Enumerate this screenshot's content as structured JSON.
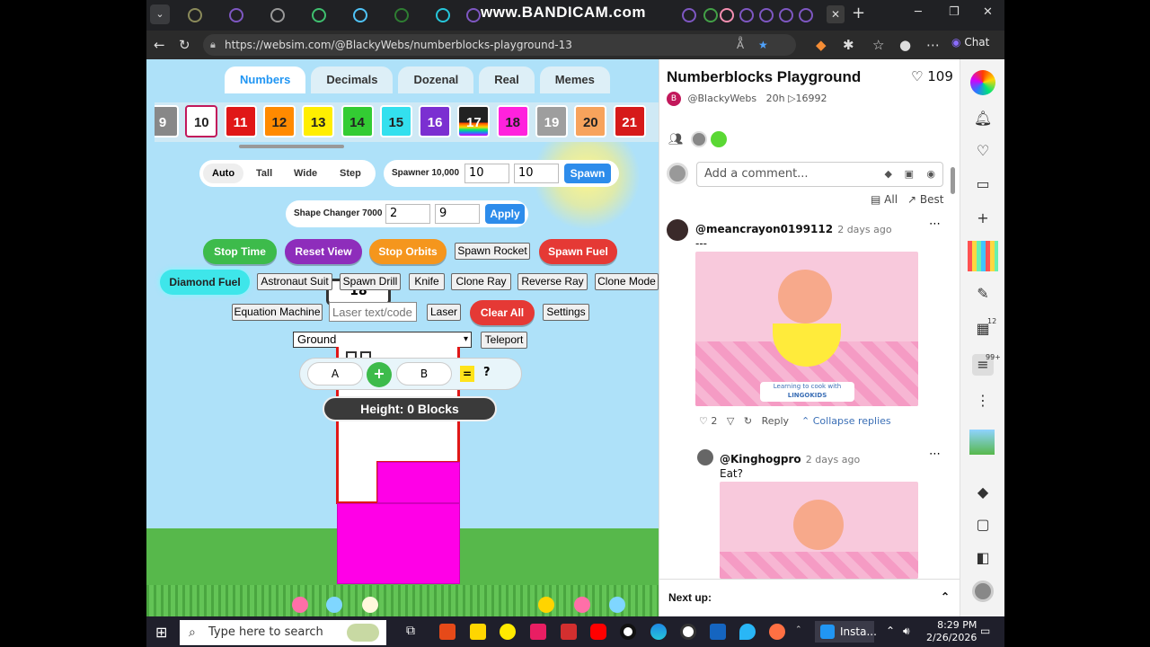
{
  "browser": {
    "watermark": "www.BANDICAM.com",
    "url": "https://websim.com/@BlackyWebs/numberblocks-playground-13",
    "chat_label": "Chat"
  },
  "game": {
    "mode_tabs": [
      "Numbers",
      "Decimals",
      "Dozenal",
      "Real",
      "Memes"
    ],
    "number_tiles": [
      {
        "label": "9",
        "color": "#888888"
      },
      {
        "label": "10",
        "color": "#ffffff"
      },
      {
        "label": "11",
        "color": "#e01717"
      },
      {
        "label": "12",
        "color": "#ff8a00"
      },
      {
        "label": "13",
        "color": "#ffee00"
      },
      {
        "label": "14",
        "color": "#33cc33"
      },
      {
        "label": "15",
        "color": "#33e0ee"
      },
      {
        "label": "16",
        "color": "#7b2fd1"
      },
      {
        "label": "17",
        "color": "#222222"
      },
      {
        "label": "18",
        "color": "#ff22dd"
      },
      {
        "label": "19",
        "color": "#9e9e9e"
      },
      {
        "label": "20",
        "color": "#f7a35c"
      },
      {
        "label": "21",
        "color": "#d61a1a"
      }
    ],
    "layout_modes": [
      "Auto",
      "Tall",
      "Wide",
      "Step"
    ],
    "spawner_label": "Spawner 10,000",
    "spawner_a": "10",
    "spawner_b": "10",
    "spawn_button": "Spawn",
    "shape_changer_label": "Shape Changer 7000",
    "shape_a": "2",
    "shape_b": "9",
    "apply_button": "Apply",
    "row1_buttons": [
      {
        "label": "Stop Time",
        "color": "#3dbb4b"
      },
      {
        "label": "Reset View",
        "color": "#8e2dbb"
      },
      {
        "label": "Stop Orbits",
        "color": "#f5961d"
      },
      {
        "label": "Spawn Rocket",
        "color": "plain"
      },
      {
        "label": "Spawn Fuel",
        "color": "#e53935"
      }
    ],
    "diamond_fuel": "Diamond Fuel",
    "row2_buttons": [
      "Astronaut Suit",
      "Spawn Drill",
      "Knife",
      "Clone Ray",
      "Reverse Ray",
      "Clone Mode"
    ],
    "equation_machine": "Equation Machine",
    "laser_placeholder": "Laser text/code",
    "laser_button": "Laser",
    "clear_all": "Clear All",
    "settings": "Settings",
    "ground_select": "Ground",
    "teleport": "Teleport",
    "equation": {
      "a": "A",
      "op": "+",
      "b": "B",
      "eq": "=",
      "result": "?"
    },
    "character_label": "18",
    "height_text": "Height: 0 Blocks"
  },
  "panel": {
    "title": "Numberblocks Playground",
    "likes": "109",
    "author": "@BlackyWebs",
    "age": "20h",
    "views": "▷16992",
    "comment_placeholder": "Add a comment...",
    "filter_all": "All",
    "filter_best": "Best",
    "comments": [
      {
        "user": "@meancrayon0199112",
        "time": "2 days ago",
        "text": "---",
        "image_caption": "Learning to cook with",
        "image_brand": "LINGOKIDS",
        "likes": "2",
        "reply": "Reply",
        "collapse": "Collapse replies"
      },
      {
        "user": "@Kinghogpro",
        "time": "2 days ago",
        "text": "Eat?"
      }
    ],
    "next_up": "Next up:"
  },
  "sidebar": {
    "badge_collections": "12",
    "badge_comments": "99+"
  },
  "taskbar": {
    "search_placeholder": "Type here to search",
    "instagram_label": "Insta...",
    "time": "8:29 PM",
    "date": "2/26/2026"
  }
}
